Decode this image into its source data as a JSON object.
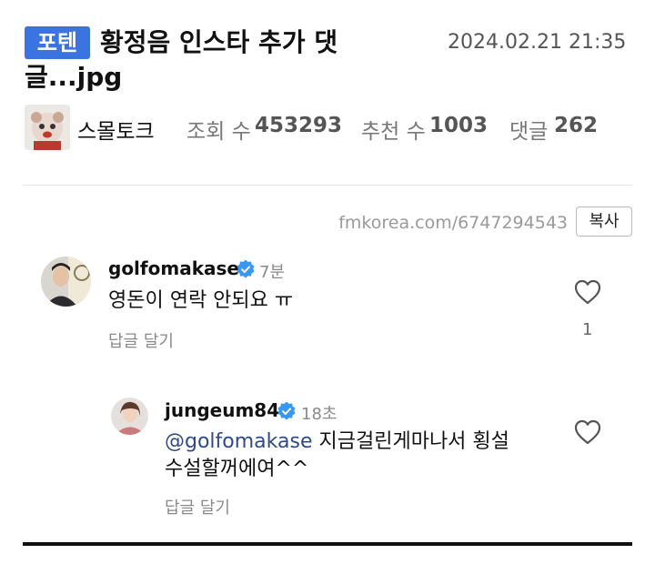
{
  "post": {
    "category_tag": "포텐",
    "title_line1": "황정음 인스타 추가 댓",
    "title_line2": "글...jpg",
    "datetime": "2024.02.21 21:35"
  },
  "author": {
    "name": "스몰토크"
  },
  "stats": {
    "views_label": "조회 수",
    "views": "453293",
    "likes_label": "추천 수",
    "likes": "1003",
    "comments_label": "댓글",
    "comments": "262"
  },
  "share": {
    "url": "fmkorea.com/6747294543",
    "copy_label": "복사"
  },
  "comments": [
    {
      "username": "golfomakase",
      "time": "7분",
      "text": "영돈이 연락 안되요 ㅠ",
      "reply_label": "답글 달기",
      "like_count": "1"
    },
    {
      "username": "jungeum84",
      "time": "18초",
      "mention": "@golfomakase",
      "text_line1": "지금걸린게마나서 횡설",
      "text_line2": "수설할꺼에여^^",
      "reply_label": "답글 달기"
    }
  ],
  "colors": {
    "tag_bg": "#3b74e0",
    "verified": "#3897f0",
    "mention": "#2f4a86"
  }
}
